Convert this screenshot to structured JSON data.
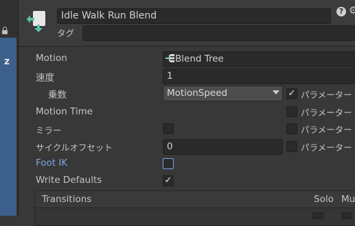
{
  "header": {
    "name_value": "Idle Walk Run Blend",
    "tag_label": "タグ",
    "help_icon": "?",
    "settings_icon": "⚙"
  },
  "props": {
    "motion_label": "Motion",
    "motion_value": "Blend Tree",
    "speed_label": "速度",
    "speed_value": "1",
    "multiplier_label": "乗数",
    "multiplier_value": "MotionSpeed",
    "motion_time_label": "Motion Time",
    "mirror_label": "ミラー",
    "cycle_offset_label": "サイクルオフセット",
    "cycle_offset_value": "0",
    "foot_ik_label": "Foot IK",
    "write_defaults_label": "Write Defaults",
    "parameter_label": "パラメーター"
  },
  "transitions": {
    "header_label": "Transitions",
    "solo_label": "Solo",
    "mute_label": "Mu"
  },
  "left_panel": {
    "glyph": "z"
  },
  "colors": {
    "foot_ik": "#7fa6e4",
    "accent_blue": "#3c5f8c"
  }
}
